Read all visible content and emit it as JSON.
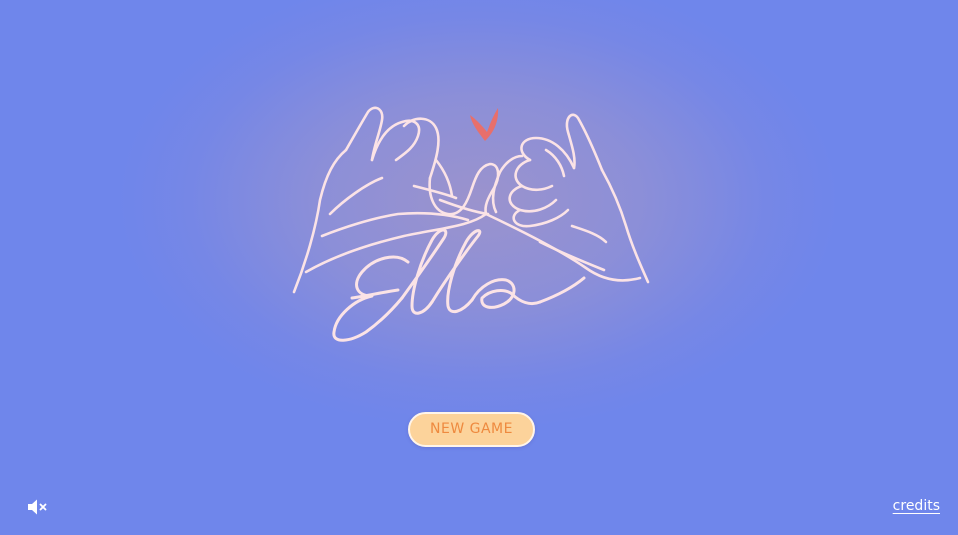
{
  "game": {
    "title": "Ella"
  },
  "menu": {
    "new_game_label": "NEW GAME"
  },
  "footer": {
    "sound_icon": "speaker-muted-icon",
    "credits_label": "credits"
  },
  "colors": {
    "background": "#7687e6",
    "line_art": "#fbe3e6",
    "heart": "#e86f6b",
    "button_fill": "#fcd39b",
    "button_text": "#ee8a3f",
    "button_border": "#fff5ea"
  }
}
